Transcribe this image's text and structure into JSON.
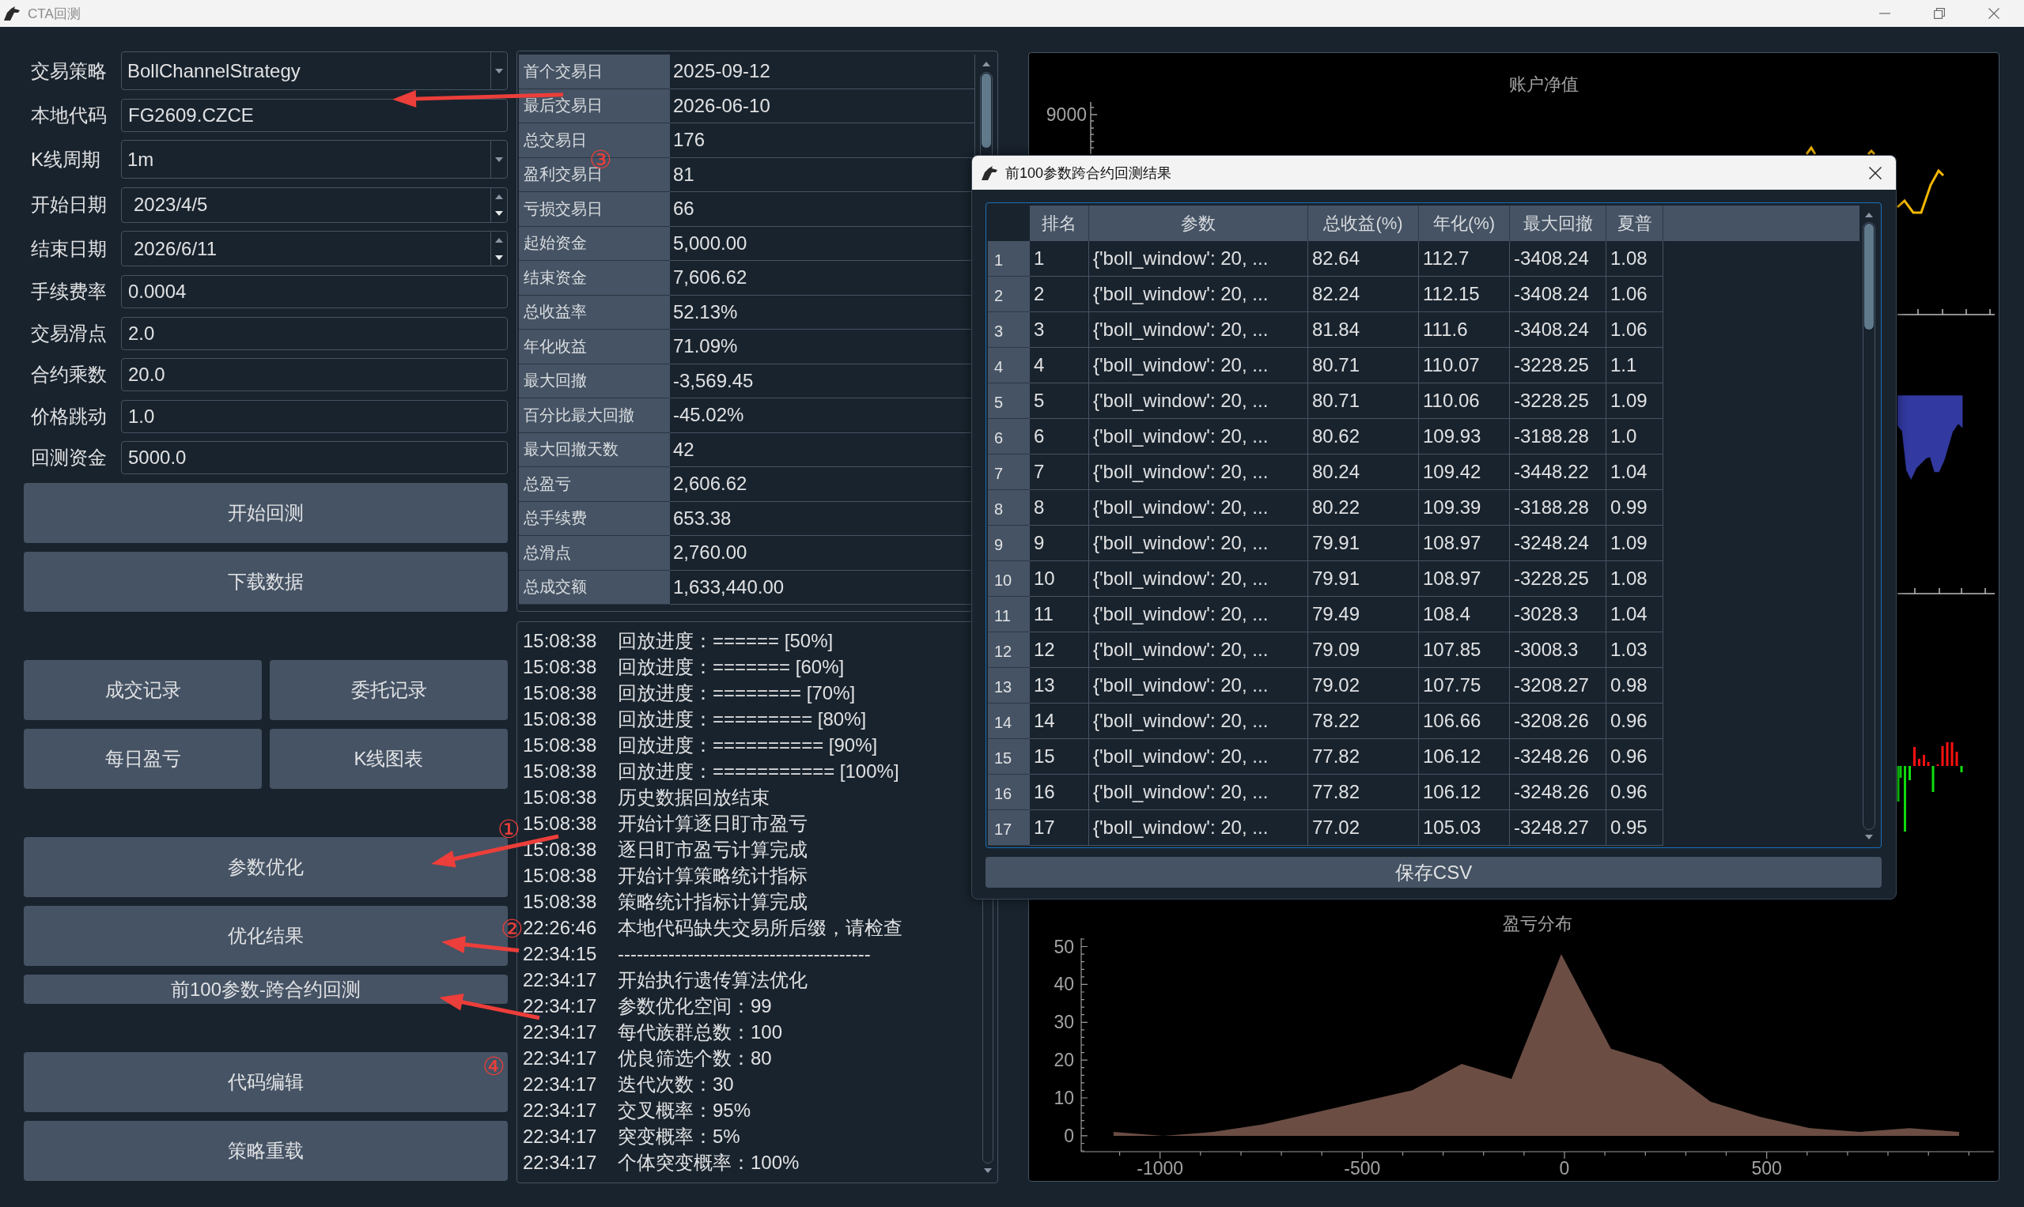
{
  "window": {
    "title": "CTA回测",
    "active": false
  },
  "form": {
    "fields": [
      {
        "label": "交易策略",
        "value": "BollChannelStrategy",
        "kind": "combo"
      },
      {
        "label": "本地代码",
        "value": "FG2609.CZCE",
        "kind": "text"
      },
      {
        "label": "K线周期",
        "value": "1m",
        "kind": "combo"
      },
      {
        "label": "开始日期",
        "value": "2023/4/5",
        "kind": "date"
      },
      {
        "label": "结束日期",
        "value": "2026/6/11",
        "kind": "date"
      },
      {
        "label": "手续费率",
        "value": "0.0004",
        "kind": "text"
      },
      {
        "label": "交易滑点",
        "value": "2.0",
        "kind": "text"
      },
      {
        "label": "合约乘数",
        "value": "20.0",
        "kind": "text"
      },
      {
        "label": "价格跳动",
        "value": "1.0",
        "kind": "text"
      },
      {
        "label": "回测资金",
        "value": "5000.0",
        "kind": "text"
      }
    ]
  },
  "button_groups": [
    {
      "kind": "column",
      "buttons": [
        {
          "label": "开始回测",
          "kind": "tall"
        },
        {
          "label": "下载数据",
          "kind": "tall"
        }
      ]
    },
    {
      "kind": "grid",
      "buttons": [
        {
          "label": "成交记录",
          "kind": "tall"
        },
        {
          "label": "委托记录",
          "kind": "tall"
        },
        {
          "label": "每日盈亏",
          "kind": "tall"
        },
        {
          "label": "K线图表",
          "kind": "tall"
        }
      ]
    },
    {
      "kind": "column",
      "buttons": [
        {
          "label": "参数优化",
          "kind": "tall"
        },
        {
          "label": "优化结果",
          "kind": "tall"
        },
        {
          "label": "前100参数-跨合约回测",
          "kind": "short"
        }
      ]
    },
    {
      "kind": "column",
      "buttons": [
        {
          "label": "代码编辑",
          "kind": "tall"
        },
        {
          "label": "策略重载",
          "kind": "tall"
        }
      ]
    }
  ],
  "statistics": [
    {
      "label": "首个交易日",
      "value": "2025-09-12"
    },
    {
      "label": "最后交易日",
      "value": "2026-06-10"
    },
    {
      "label": "总交易日",
      "value": "176"
    },
    {
      "label": "盈利交易日",
      "value": "81"
    },
    {
      "label": "亏损交易日",
      "value": "66"
    },
    {
      "label": "起始资金",
      "value": "5,000.00"
    },
    {
      "label": "结束资金",
      "value": "7,606.62"
    },
    {
      "label": "总收益率",
      "value": "52.13%"
    },
    {
      "label": "年化收益",
      "value": "71.09%"
    },
    {
      "label": "最大回撤",
      "value": "-3,569.45"
    },
    {
      "label": "百分比最大回撤",
      "value": "-45.02%"
    },
    {
      "label": "最大回撤天数",
      "value": "42"
    },
    {
      "label": "总盈亏",
      "value": "2,606.62"
    },
    {
      "label": "总手续费",
      "value": "653.38"
    },
    {
      "label": "总滑点",
      "value": "2,760.00"
    },
    {
      "label": "总成交额",
      "value": "1,633,440.00"
    }
  ],
  "log": [
    {
      "time": "15:08:38",
      "text": "回放进度：====== [50%]"
    },
    {
      "time": "15:08:38",
      "text": "回放进度：======= [60%]"
    },
    {
      "time": "15:08:38",
      "text": "回放进度：======== [70%]"
    },
    {
      "time": "15:08:38",
      "text": "回放进度：========= [80%]"
    },
    {
      "time": "15:08:38",
      "text": "回放进度：========== [90%]"
    },
    {
      "time": "15:08:38",
      "text": "回放进度：=========== [100%]"
    },
    {
      "time": "15:08:38",
      "text": "历史数据回放结束"
    },
    {
      "time": "15:08:38",
      "text": "开始计算逐日盯市盈亏"
    },
    {
      "time": "15:08:38",
      "text": "逐日盯市盈亏计算完成"
    },
    {
      "time": "15:08:38",
      "text": "开始计算策略统计指标"
    },
    {
      "time": "15:08:38",
      "text": "策略统计指标计算完成"
    },
    {
      "time": "22:26:46",
      "text": "本地代码缺失交易所后缀，请检查"
    },
    {
      "time": "22:34:15",
      "text": "----------------------------------------"
    },
    {
      "time": "22:34:17",
      "text": "开始执行遗传算法优化"
    },
    {
      "time": "22:34:17",
      "text": "参数优化空间：99"
    },
    {
      "time": "22:34:17",
      "text": "每代族群总数：100"
    },
    {
      "time": "22:34:17",
      "text": "优良筛选个数：80"
    },
    {
      "time": "22:34:17",
      "text": "迭代次数：30"
    },
    {
      "time": "22:34:17",
      "text": "交叉概率：95%"
    },
    {
      "time": "22:34:17",
      "text": "突变概率：5%"
    },
    {
      "time": "22:34:17",
      "text": "个体突变概率：100%"
    }
  ],
  "charts": {
    "equity": {
      "title": "账户净值",
      "tick_labels": [
        "9000"
      ]
    },
    "pnl_distribution": {
      "chart_data": {
        "type": "area",
        "title": "盈亏分布",
        "x": [
          -1115,
          -992,
          -869,
          -746,
          -623,
          -500,
          -377,
          -254,
          -131,
          -8,
          115,
          238,
          361,
          484,
          607,
          730,
          853,
          976
        ],
        "series": [
          {
            "color": "#6b4d43",
            "values": [
              1,
              0,
              1,
              3,
              6,
              9,
              12,
              19,
              15,
              48,
              23,
              19,
              9,
              5,
              2,
              1,
              2,
              1
            ]
          }
        ],
        "xlim": [
          -1195,
          1062
        ],
        "ylim": [
          -4.2,
          52.2
        ],
        "xticks": [
          -1000,
          -500,
          0,
          500
        ],
        "yticks": [
          0,
          10,
          20,
          30,
          40,
          50
        ]
      }
    }
  },
  "dialog": {
    "title": "前100参数跨合约回测结果",
    "active": true,
    "table": {
      "columns": [
        "排名",
        "参数",
        "总收益(%)",
        "年化(%)",
        "最大回撤",
        "夏普"
      ],
      "rows": [
        {
          "header": "1",
          "cells": [
            "1",
            "{'boll_window': 20, ...",
            "82.64",
            "112.7",
            "-3408.24",
            "1.08"
          ]
        },
        {
          "header": "2",
          "cells": [
            "2",
            "{'boll_window': 20, ...",
            "82.24",
            "112.15",
            "-3408.24",
            "1.06"
          ]
        },
        {
          "header": "3",
          "cells": [
            "3",
            "{'boll_window': 20, ...",
            "81.84",
            "111.6",
            "-3408.24",
            "1.06"
          ]
        },
        {
          "header": "4",
          "cells": [
            "4",
            "{'boll_window': 20, ...",
            "80.71",
            "110.07",
            "-3228.25",
            "1.1"
          ]
        },
        {
          "header": "5",
          "cells": [
            "5",
            "{'boll_window': 20, ...",
            "80.71",
            "110.06",
            "-3228.25",
            "1.09"
          ]
        },
        {
          "header": "6",
          "cells": [
            "6",
            "{'boll_window': 20, ...",
            "80.62",
            "109.93",
            "-3188.28",
            "1.0"
          ]
        },
        {
          "header": "7",
          "cells": [
            "7",
            "{'boll_window': 20, ...",
            "80.24",
            "109.42",
            "-3448.22",
            "1.04"
          ]
        },
        {
          "header": "8",
          "cells": [
            "8",
            "{'boll_window': 20, ...",
            "80.22",
            "109.39",
            "-3188.28",
            "0.99"
          ]
        },
        {
          "header": "9",
          "cells": [
            "9",
            "{'boll_window': 20, ...",
            "79.91",
            "108.97",
            "-3248.24",
            "1.09"
          ]
        },
        {
          "header": "10",
          "cells": [
            "10",
            "{'boll_window': 20, ...",
            "79.91",
            "108.97",
            "-3228.25",
            "1.08"
          ]
        },
        {
          "header": "11",
          "cells": [
            "11",
            "{'boll_window': 20, ...",
            "79.49",
            "108.4",
            "-3028.3",
            "1.04"
          ]
        },
        {
          "header": "12",
          "cells": [
            "12",
            "{'boll_window': 20, ...",
            "79.09",
            "107.85",
            "-3008.3",
            "1.03"
          ]
        },
        {
          "header": "13",
          "cells": [
            "13",
            "{'boll_window': 20, ...",
            "79.02",
            "107.75",
            "-3208.27",
            "0.98"
          ]
        },
        {
          "header": "14",
          "cells": [
            "14",
            "{'boll_window': 20, ...",
            "78.22",
            "106.66",
            "-3208.26",
            "0.96"
          ]
        },
        {
          "header": "15",
          "cells": [
            "15",
            "{'boll_window': 20, ...",
            "77.82",
            "106.12",
            "-3248.26",
            "0.96"
          ]
        },
        {
          "header": "16",
          "cells": [
            "16",
            "{'boll_window': 20, ...",
            "77.82",
            "106.12",
            "-3248.26",
            "0.96"
          ]
        },
        {
          "header": "17",
          "cells": [
            "17",
            "{'boll_window': 20, ...",
            "77.02",
            "105.03",
            "-3248.27",
            "0.95"
          ]
        }
      ]
    },
    "button": "保存CSV"
  },
  "annotations": [
    {
      "kind": "arrow"
    },
    {
      "kind": "number",
      "text": "③"
    },
    {
      "kind": "number",
      "text": "①"
    },
    {
      "kind": "arrow"
    },
    {
      "kind": "number",
      "text": "②"
    },
    {
      "kind": "arrow"
    },
    {
      "kind": "arrow"
    },
    {
      "kind": "number",
      "text": "④"
    }
  ]
}
